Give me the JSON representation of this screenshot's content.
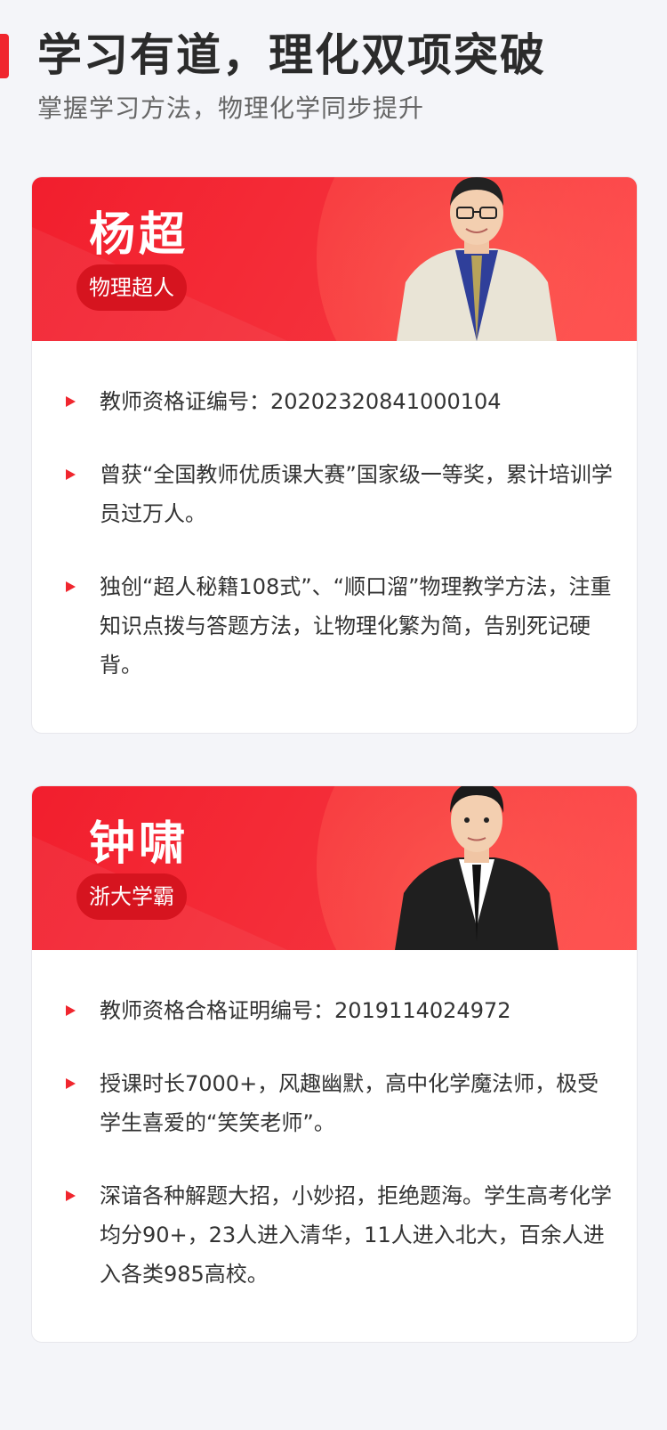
{
  "header": {
    "title": "学习有道，理化双项突破",
    "subtitle": "掌握学习方法，物理化学同步提升"
  },
  "teachers": [
    {
      "name": "杨超",
      "tag": "物理超人",
      "items": [
        "教师资格证编号：20202320841000104",
        "曾获“全国教师优质课大赛”国家级一等奖，累计培训学员过万人。",
        "独创“超人秘籍108式”、“顺口溜”物理教学方法，注重知识点拨与答题方法，让物理化繁为简，告别死记硬背。"
      ]
    },
    {
      "name": "钟啸",
      "tag": "浙大学霸",
      "items": [
        "教师资格合格证明编号：2019114024972",
        "授课时长7000+，风趣幽默，高中化学魔法师，极受学生喜爱的“笑笑老师”。",
        "深谙各种解题大招，小妙招，拒绝题海。学生高考化学均分90+，23人进入清华，11人进入北大，百余人进入各类985高校。"
      ]
    }
  ],
  "colors": {
    "accent": "#f0262e",
    "tag_bg": "#d6141f",
    "card_bg": "#ffffff",
    "page_bg": "#f4f5f9"
  },
  "icons": {
    "bullet": "red-triangle-bullet-icon"
  }
}
